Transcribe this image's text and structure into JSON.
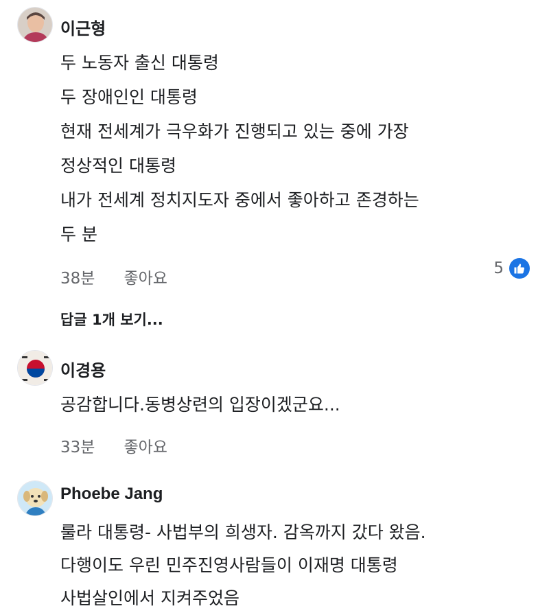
{
  "comments": [
    {
      "author": "이근형",
      "lines": [
        "두 노동자 출신 대통령",
        "두 장애인인 대통령",
        "현재 전세계가 극우화가 진행되고 있는 중에 가장",
        "정상적인 대통령",
        "내가 전세계 정치지도자 중에서 좋아하고 존경하는",
        "두 분"
      ],
      "time": "38분",
      "like_label": "좋아요",
      "reaction_count": "5",
      "replies_label": "답글 1개 보기..."
    },
    {
      "author": "이경용",
      "lines": [
        "공감합니다.동병상련의 입장이겠군요..."
      ],
      "time": "33분",
      "like_label": "좋아요"
    },
    {
      "author": "Phoebe Jang",
      "lines": [
        "룰라 대통령- 사법부의 희생자. 감옥까지 갔다 왔음.",
        "다행이도 우린 민주진영사람들이 이재명 대통령",
        "사법살인에서 지켜주었음"
      ]
    }
  ],
  "colors": {
    "text": "#1c1e21",
    "meta": "#65676b",
    "like_blue": "#1b74e4"
  },
  "icons": [
    "avatar-photo",
    "thumbs-up-icon"
  ]
}
